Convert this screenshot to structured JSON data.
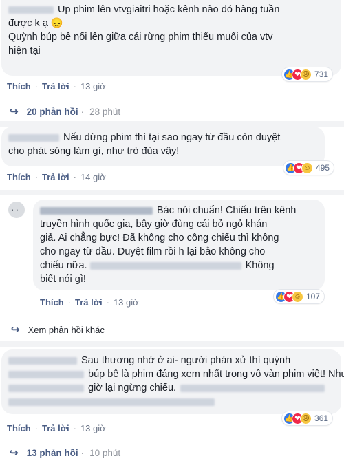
{
  "comments": [
    {
      "lines": [
        "Up phim lên vtvgiaitri hoặc kênh nào đó hàng tuần",
        "được k ạ 😞",
        "Quỳnh búp bê nổi lên giữa cái rừng phim thiếu muối của vtv",
        "hiện tại"
      ],
      "like_label": "Thích",
      "reply_label": "Trả lời",
      "time": "13 giờ",
      "reaction_count": "731",
      "replies_label": "20 phản hồi",
      "replies_time": "28 phút"
    },
    {
      "lines": [
        "Nếu dừng phim thì tại sao ngay từ đầu còn duyệt",
        "cho phát sóng làm gì, như trò đùa vậy!"
      ],
      "like_label": "Thích",
      "reply_label": "Trả lời",
      "time": "14 giờ",
      "reaction_count": "495"
    },
    {
      "lines": [
        "Bác nói chuẩn! Chiếu trên kênh",
        "truyền hình quốc gia, bây giờ đùng cái bỏ ngỏ khán",
        "giả. Ai chẳng bực! Đã không cho công chiếu thì không",
        "cho ngay từ đầu. Duyệt film rồi h lại bảo không cho",
        "chiếu nữa.",
        "Không",
        "biết nói gì!"
      ],
      "like_label": "Thích",
      "reply_label": "Trả lời",
      "time": "13 giờ",
      "reaction_count": "107",
      "more_replies": "Xem phản hồi khác"
    },
    {
      "lines": [
        "Sau thương nhớ ở ai- người phán xử thì quỳnh",
        "búp bê là phim đáng xem nhất trong vô vàn phim việt! Nhưng",
        "giờ lại ngừng chiếu."
      ],
      "like_label": "Thích",
      "reply_label": "Trả lời",
      "time": "13 giờ",
      "reaction_count": "361",
      "replies_label": "13 phản hồi",
      "replies_time": "10 phút"
    }
  ]
}
